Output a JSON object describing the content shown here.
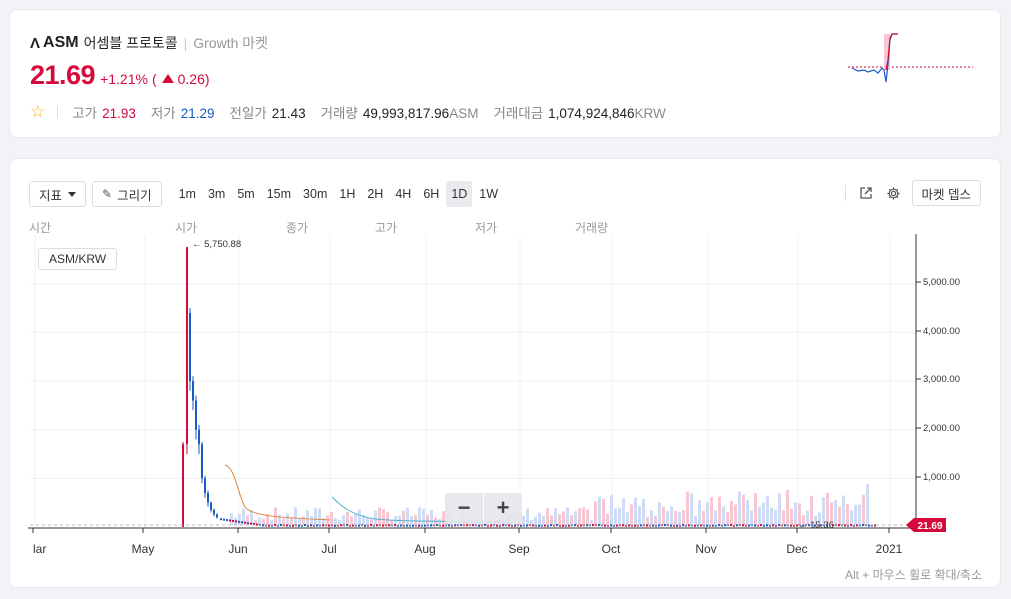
{
  "header": {
    "logo": "Λ",
    "symbol": "ASM",
    "korean_name": "어셈블 프로토콜",
    "market": "Growth 마켓",
    "price": "21.69",
    "change_pct": "+1.21%",
    "change_open": "(",
    "change_abs": "0.26)",
    "high_label": "고가",
    "high_value": "21.93",
    "low_label": "저가",
    "low_value": "21.29",
    "prev_label": "전일가",
    "prev_value": "21.43",
    "volume_label": "거래량",
    "volume_value": "49,993,817.96",
    "volume_unit": "ASM",
    "amount_label": "거래대금",
    "amount_value": "1,074,924,846",
    "amount_unit": "KRW"
  },
  "toolbar": {
    "indicator_label": "지표",
    "draw_label": "그리기",
    "intervals": [
      "1m",
      "3m",
      "5m",
      "15m",
      "30m",
      "1H",
      "2H",
      "4H",
      "6H",
      "1D",
      "1W"
    ],
    "active_interval": "1D",
    "depth_label": "마켓 뎁스"
  },
  "legend": {
    "time": "시간",
    "open": "시가",
    "close": "종가",
    "high": "고가",
    "low": "저가",
    "volume": "거래량"
  },
  "pair_label": "ASM/KRW",
  "hint": "Alt + 마우스 휠로 확대/축소",
  "colors": {
    "up": "#d60a3a",
    "down": "#1a5ac4",
    "accent_line": "#d60a3a"
  },
  "chart_data": {
    "type": "candlestick",
    "x_ticks": [
      "lar",
      "May",
      "Jun",
      "Jul",
      "Aug",
      "Sep",
      "Oct",
      "Nov",
      "Dec",
      "2021"
    ],
    "y_ticks": [
      "1,000.00",
      "2,000.00",
      "3,000.00",
      "4,000.00",
      "5,000.00"
    ],
    "ylim": [
      0,
      6000
    ],
    "max_label": "← 5,750.88",
    "min_label": "← 15.36",
    "current_price_tag": "21.69",
    "daily_close_approx": [
      {
        "date": "May 13",
        "value": 1700
      },
      {
        "date": "May 14",
        "value": 5750.88
      },
      {
        "date": "May 15",
        "value": 4400
      },
      {
        "date": "May 16",
        "value": 3000
      },
      {
        "date": "May 17",
        "value": 2600
      },
      {
        "date": "May 18",
        "value": 2000
      },
      {
        "date": "May 20",
        "value": 1000
      },
      {
        "date": "May 25",
        "value": 500
      },
      {
        "date": "Jun 1",
        "value": 200
      },
      {
        "date": "Jul 1",
        "value": 60
      },
      {
        "date": "Aug 1",
        "value": 30
      },
      {
        "date": "Oct 1",
        "value": 25
      },
      {
        "date": "Dec 1",
        "value": 15.36
      },
      {
        "date": "Dec 24",
        "value": 21.69
      }
    ]
  }
}
